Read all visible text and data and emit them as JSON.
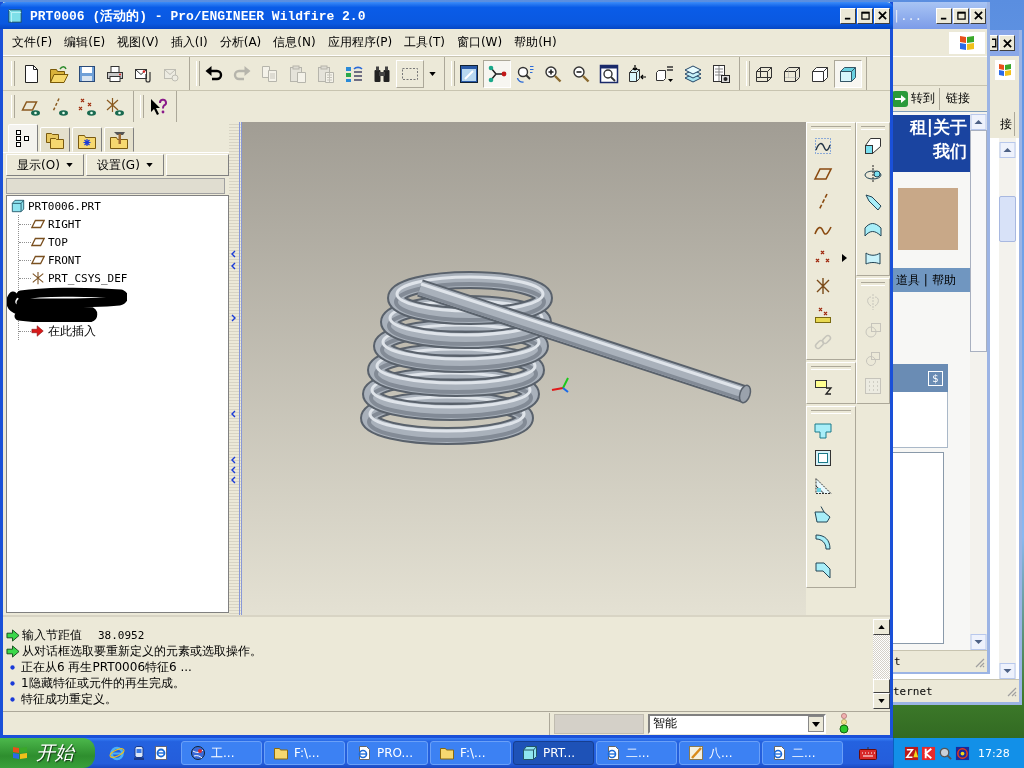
{
  "main_window": {
    "title": "PRT0006 (活动的) - Pro/ENGINEER Wildfire 2.0"
  },
  "menu": [
    "文件(F)",
    "编辑(E)",
    "视图(V)",
    "插入(I)",
    "分析(A)",
    "信息(N)",
    "应用程序(P)",
    "工具(T)",
    "窗口(W)",
    "帮助(H)"
  ],
  "toolbar": {
    "groups": [
      [
        {
          "pressed": false,
          "disabled": false
        },
        {
          "pressed": false,
          "disabled": false
        },
        {
          "pressed": false,
          "disabled": false
        },
        {
          "pressed": false,
          "disabled": false
        },
        {
          "pressed": false,
          "disabled": false
        },
        {
          "pressed": false,
          "disabled": true
        }
      ],
      [
        {
          "pressed": false,
          "disabled": false
        },
        {
          "pressed": false,
          "disabled": true
        },
        {
          "pressed": false,
          "disabled": true
        },
        {
          "pressed": false,
          "disabled": true
        },
        {
          "pressed": false,
          "disabled": true
        },
        {
          "pressed": false,
          "disabled": false
        },
        {
          "pressed": false,
          "disabled": false
        },
        {
          "pressed": false,
          "disabled": false
        }
      ],
      [
        {
          "pressed": false,
          "disabled": false
        },
        {
          "pressed": true,
          "disabled": false
        },
        {
          "pressed": false,
          "disabled": false
        },
        {
          "pressed": false,
          "disabled": false
        },
        {
          "pressed": false,
          "disabled": false
        },
        {
          "pressed": false,
          "disabled": false
        },
        {
          "pressed": false,
          "disabled": false
        },
        {
          "pressed": false,
          "disabled": false
        },
        {
          "pressed": false,
          "disabled": false
        },
        {
          "pressed": false,
          "disabled": false
        }
      ],
      [
        {
          "pressed": false,
          "disabled": false
        },
        {
          "pressed": false,
          "disabled": false
        },
        {
          "pressed": false,
          "disabled": false
        },
        {
          "pressed": true,
          "disabled": false
        }
      ]
    ]
  },
  "model_tree": {
    "tabs": [
      {
        "selected": true
      },
      {
        "selected": false
      },
      {
        "selected": false
      },
      {
        "selected": false
      }
    ],
    "menus": [
      "显示(O)",
      "设置(G)"
    ],
    "root": {
      "label": "PRT0006.PRT",
      "children": [
        {
          "kind": "plane",
          "label": "RIGHT"
        },
        {
          "kind": "plane",
          "label": "TOP"
        },
        {
          "kind": "plane",
          "label": "FRONT"
        },
        {
          "kind": "csys",
          "label": "PRT_CSYS_DEF"
        },
        {
          "kind": "redacted"
        },
        {
          "kind": "insert",
          "label": "在此插入"
        }
      ]
    }
  },
  "feature_toolbars": [
    {
      "groups": [
        [
          {
            "disabled": false
          },
          {
            "disabled": false
          },
          {
            "disabled": false
          },
          {
            "disabled": false
          },
          {
            "disabled": false
          },
          {
            "disabled": false
          },
          {
            "disabled": false
          },
          {
            "disabled": true
          }
        ],
        [
          {
            "disabled": false
          }
        ],
        [
          {
            "disabled": false
          },
          {
            "disabled": false
          },
          {
            "disabled": false
          },
          {
            "disabled": false
          },
          {
            "disabled": false
          },
          {
            "disabled": false
          }
        ]
      ]
    },
    {
      "groups": [
        [
          {
            "disabled": false
          },
          {
            "disabled": false
          },
          {
            "disabled": false
          },
          {
            "disabled": false
          },
          {
            "disabled": false
          }
        ],
        [
          {
            "disabled": true
          },
          {
            "disabled": true
          },
          {
            "disabled": true
          },
          {
            "disabled": true
          }
        ]
      ]
    }
  ],
  "messages": [
    {
      "kind": "prompt",
      "text": "输入节距值",
      "value": "38.0952"
    },
    {
      "kind": "prompt",
      "text": "从对话框选取要重新定义的元素或选取操作。"
    },
    {
      "kind": "info",
      "text": "正在从6 再生PRT0006特征6 ..."
    },
    {
      "kind": "info",
      "text": "1隐藏特征或元件的再生完成。"
    },
    {
      "kind": "info",
      "text": "特征成功重定义。"
    }
  ],
  "status_bar": {
    "filter": "智能"
  },
  "taskbar": {
    "start": "开始",
    "tasks": [
      {
        "kind": "app",
        "label": "工...",
        "selected": false
      },
      {
        "kind": "folder",
        "label": "F:\\...",
        "selected": false
      },
      {
        "kind": "web",
        "label": "PRO...",
        "selected": false
      },
      {
        "kind": "folder",
        "label": "F:\\...",
        "selected": false
      },
      {
        "kind": "part",
        "label": "PRT...",
        "selected": true
      },
      {
        "kind": "web",
        "label": "二...",
        "selected": false
      },
      {
        "kind": "pen",
        "label": "八...",
        "selected": false
      },
      {
        "kind": "web",
        "label": "二...",
        "selected": false
      }
    ],
    "clock": "17:28"
  },
  "browser_front": {
    "title": "|...",
    "go": "转到",
    "links": "链接",
    "banner": [
      "租|关于",
      "我们"
    ],
    "nav": "道具 | 帮助",
    "panel_button": "$",
    "status": "t"
  },
  "browser_back": {
    "links": "接",
    "status": "ternet"
  }
}
